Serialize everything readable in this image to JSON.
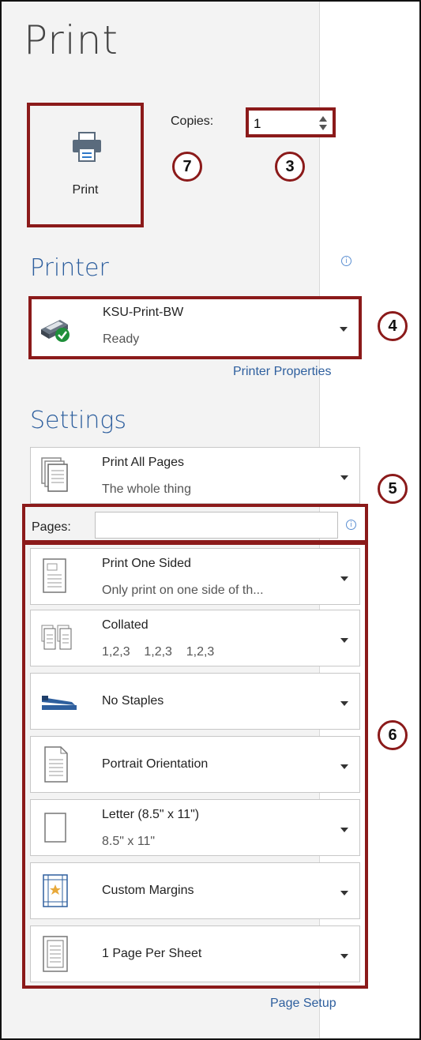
{
  "header": {
    "title": "Print"
  },
  "print_button": {
    "label": "Print",
    "icon": "printer-icon"
  },
  "copies": {
    "label": "Copies:",
    "value": "1"
  },
  "printer": {
    "section_title": "Printer",
    "name": "KSU-Print-BW",
    "status": "Ready",
    "properties_link": "Printer Properties"
  },
  "settings": {
    "section_title": "Settings",
    "pages_label": "Pages:",
    "pages_value": "",
    "options": [
      {
        "line1": "Print All Pages",
        "line2": "The whole thing",
        "icon": "all-pages-icon"
      },
      {
        "line1": "Print One Sided",
        "line2": "Only print on one side of th...",
        "icon": "one-sided-icon"
      },
      {
        "line1": "Collated",
        "line2": "1,2,3    1,2,3    1,2,3",
        "icon": "collated-icon"
      },
      {
        "line1": "No Staples",
        "line2": "",
        "icon": "stapler-icon"
      },
      {
        "line1": "Portrait Orientation",
        "line2": "",
        "icon": "portrait-icon"
      },
      {
        "line1": "Letter (8.5\" x 11\")",
        "line2": "8.5\" x 11\"",
        "icon": "letter-paper-icon"
      },
      {
        "line1": "Custom Margins",
        "line2": "",
        "icon": "margins-icon"
      },
      {
        "line1": "1 Page Per Sheet",
        "line2": "",
        "icon": "page-per-sheet-icon"
      }
    ],
    "page_setup_link": "Page Setup"
  },
  "callouts": [
    "7",
    "3",
    "4",
    "5",
    "6"
  ],
  "colors": {
    "accent_red": "#8b1a1a",
    "link_blue": "#2e5f9e",
    "status_green": "#1e8f3a"
  }
}
